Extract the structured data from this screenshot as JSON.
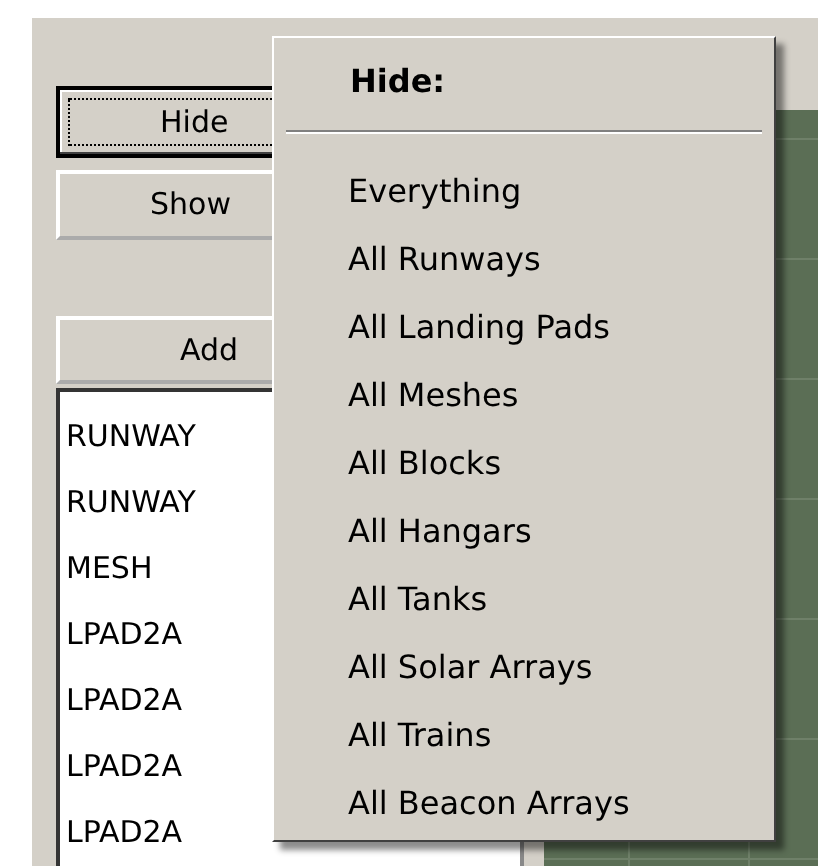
{
  "buttons": [
    {
      "label": "Hide",
      "focused": true
    },
    {
      "label": "Show",
      "focused": false
    },
    {
      "label": "Add",
      "focused": false
    }
  ],
  "list": [
    "RUNWAY",
    "RUNWAY",
    "MESH",
    "LPAD2A",
    "LPAD2A",
    "LPAD2A",
    "LPAD2A"
  ],
  "menu": {
    "title": "Hide:",
    "items": [
      "Everything",
      "All Runways",
      "All Landing Pads",
      "All Meshes",
      "All Blocks",
      "All Hangars",
      "All Tanks",
      "All Solar Arrays",
      "All Trains",
      "All Beacon Arrays"
    ]
  }
}
